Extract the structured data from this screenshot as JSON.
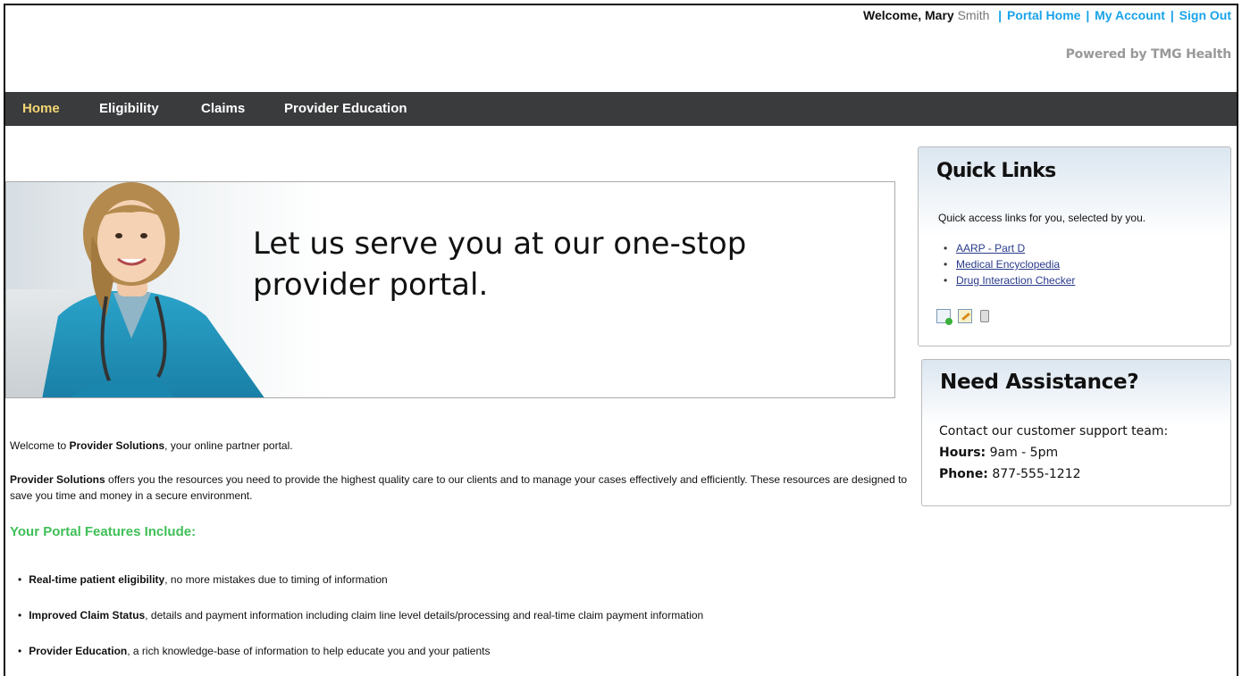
{
  "header": {
    "welcome_prefix": "Welcome, Mary",
    "welcome_last": "Smith",
    "links": [
      "Portal Home",
      "My Account",
      "Sign Out"
    ],
    "powered_by": "Powered by TMG Health"
  },
  "nav": {
    "items": [
      "Home",
      "Eligibility",
      "Claims",
      "Provider Education"
    ],
    "active": "Home"
  },
  "hero": {
    "headline": "Let us serve you at our one-stop provider portal."
  },
  "intro": {
    "p1_pre": "Welcome to ",
    "p1_brand": "Provider Solutions",
    "p1_post": ", your online partner portal.",
    "p2_brand": "Provider Solutions",
    "p2_post": " offers you the resources you need to provide the highest quality care to our clients and to manage your cases effectively and efficiently. These resources are designed to save you time and money in a secure environment."
  },
  "features": {
    "title": "Your Portal Features Include:",
    "items": [
      {
        "bold": "Real-time patient eligibility",
        "rest": ", no more mistakes due to timing of information"
      },
      {
        "bold": "Improved Claim Status",
        "rest": ", details and payment information including claim line level details/processing and real-time claim payment information"
      },
      {
        "bold": "Provider Education",
        "rest": ", a rich knowledge-base of information to help educate you and your patients"
      }
    ]
  },
  "quick_links": {
    "title": "Quick Links",
    "description": "Quick access links for you, selected by you.",
    "links": [
      "AARP - Part D",
      "Medical Encyclopedia",
      "Drug Interaction Checker"
    ],
    "icons": [
      "add-link-icon",
      "edit-link-icon",
      "delete-link-icon"
    ]
  },
  "assistance": {
    "title": "Need Assistance?",
    "contact": "Contact our customer support team:",
    "hours_label": "Hours:",
    "hours_value": " 9am - 5pm",
    "phone_label": "Phone:",
    "phone_value": " 877-555-1212"
  },
  "colors": {
    "nav_bg": "#3a3b3d",
    "nav_active": "#f2d674",
    "link_blue": "#1aa3e8",
    "feature_green": "#3fbf56"
  }
}
